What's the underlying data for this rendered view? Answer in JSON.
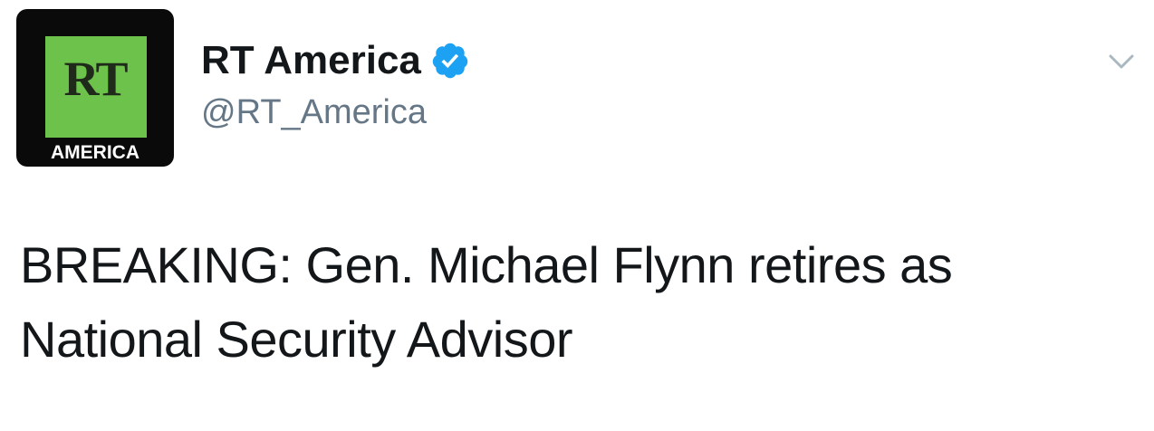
{
  "author": {
    "display_name": "RT America",
    "handle": "@RT_America",
    "verified": true,
    "avatar": {
      "logo_text": "RT",
      "subtitle": "AMERICA",
      "colors": {
        "background": "#0a0a0a",
        "green": "#6cc24a"
      }
    }
  },
  "tweet": {
    "text": "BREAKING: Gen. Michael Flynn retires as National Security Advisor"
  },
  "icons": {
    "verified": "verified-badge-icon",
    "menu": "chevron-down-icon"
  },
  "colors": {
    "text": "#14171a",
    "secondary": "#657786",
    "verified": "#1da1f2"
  }
}
